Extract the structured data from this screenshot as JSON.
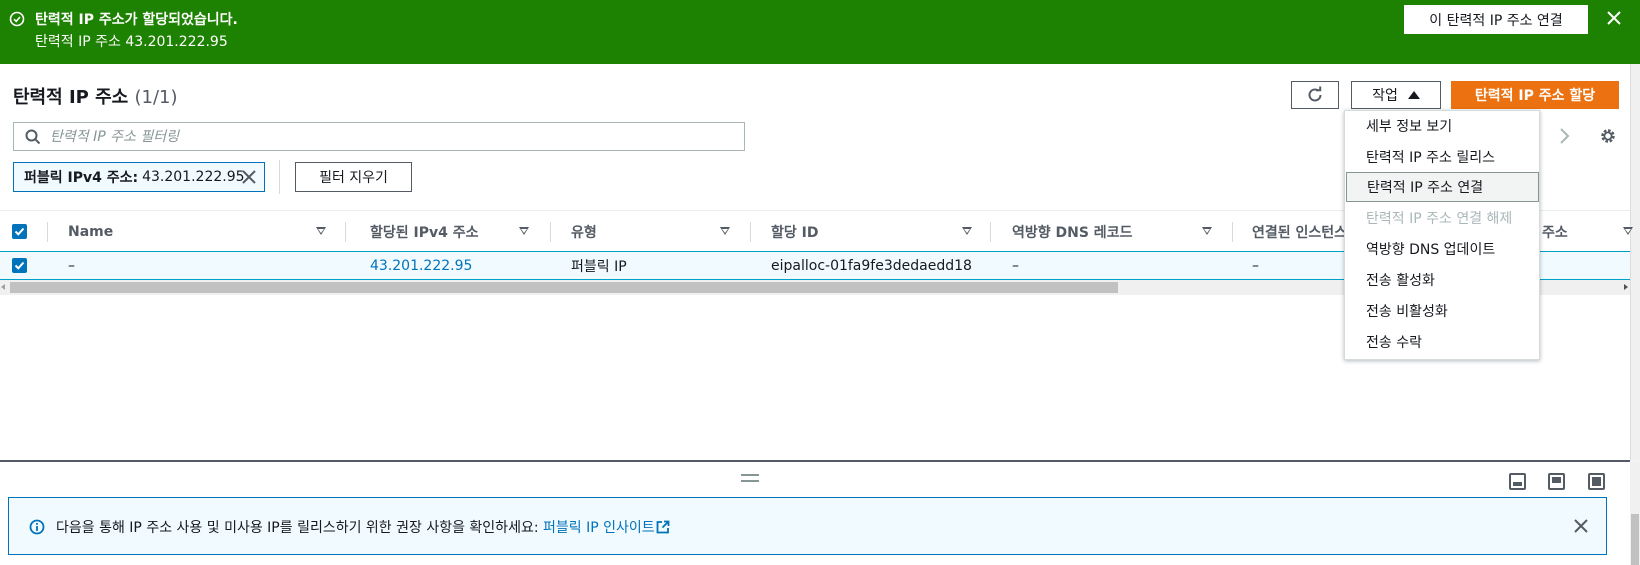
{
  "flash": {
    "title": "탄력적 IP 주소가 할당되었습니다.",
    "detail": "탄력적 IP 주소 43.201.222.95",
    "action_label": "이 탄력적 IP 주소 연결",
    "color": "#1d8102"
  },
  "header": {
    "title": "탄력적 IP 주소",
    "count": "(1/1)",
    "actions_label": "작업",
    "allocate_label": "탄력적 IP 주소 할당",
    "accent_color": "#ec7211"
  },
  "filter": {
    "placeholder": "탄력적 IP 주소 필터링",
    "token_key": "퍼블릭 IPv4 주소:",
    "token_value": "43.201.222.95",
    "clear_label": "필터 지우기"
  },
  "table": {
    "columns": [
      "Name",
      "할당된 IPv4 주소",
      "유형",
      "할당 ID",
      "역방향 DNS 레코드",
      "연결된 인스턴스",
      "주소"
    ],
    "rows": [
      {
        "name": "–",
        "ipv4": "43.201.222.95",
        "type": "퍼블릭 IP",
        "allocation_id": "eipalloc-01fa9fe3dedaedd18",
        "reverse_dns": "–",
        "instance": "–",
        "selected": true
      }
    ]
  },
  "actions_menu": {
    "items": [
      {
        "label": "세부 정보 보기",
        "disabled": false
      },
      {
        "label": "탄력적 IP 주소 릴리스",
        "disabled": false
      },
      {
        "label": "탄력적 IP 주소 연결",
        "disabled": false,
        "highlighted": true
      },
      {
        "label": "탄력적 IP 주소 연결 해제",
        "disabled": true
      },
      {
        "label": "역방향 DNS 업데이트",
        "disabled": false
      },
      {
        "label": "전송 활성화",
        "disabled": false
      },
      {
        "label": "전송 비활성화",
        "disabled": false
      },
      {
        "label": "전송 수락",
        "disabled": false
      }
    ]
  },
  "info": {
    "message": "다음을 통해 IP 주소 사용 및 미사용 IP를 릴리스하기 위한 권장 사항을 확인하세요: ",
    "link": "퍼블릭 IP 인사이트"
  }
}
